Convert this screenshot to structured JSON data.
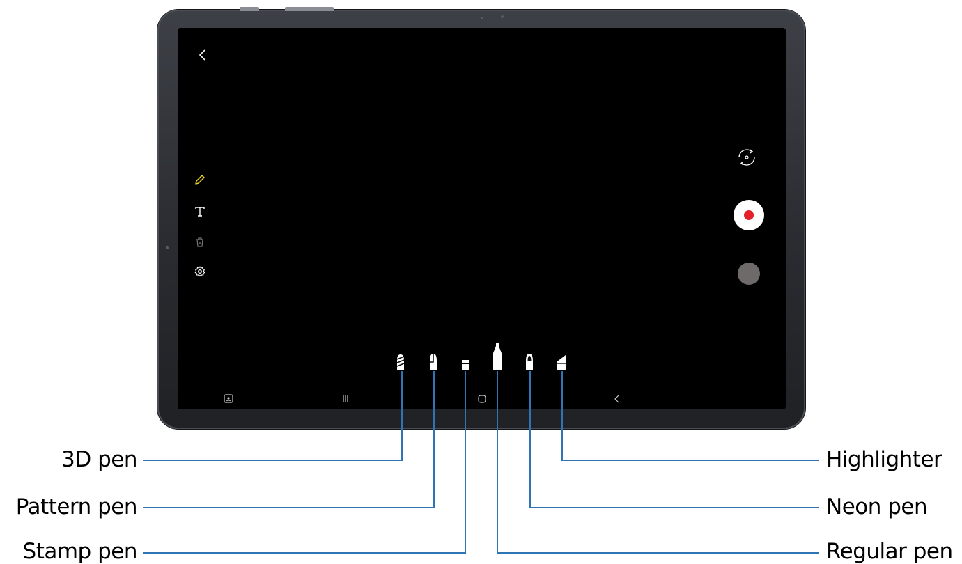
{
  "pens": [
    {
      "id": "3d",
      "label": "3D pen"
    },
    {
      "id": "pattern",
      "label": "Pattern pen"
    },
    {
      "id": "stamp",
      "label": "Stamp pen"
    },
    {
      "id": "regular",
      "label": "Regular pen"
    },
    {
      "id": "neon",
      "label": "Neon pen"
    },
    {
      "id": "highlighter",
      "label": "Highlighter"
    }
  ],
  "colors": {
    "accent": "#2f74b5",
    "record": "#e3212b",
    "pencil_active": "#e8d21f"
  },
  "icons": {
    "back": "back-arrow-icon",
    "pencil": "pencil-icon",
    "text": "text-icon",
    "delete": "trash-icon",
    "settings": "gear-icon",
    "switch_camera": "rotate-camera-icon",
    "record": "record-icon"
  }
}
